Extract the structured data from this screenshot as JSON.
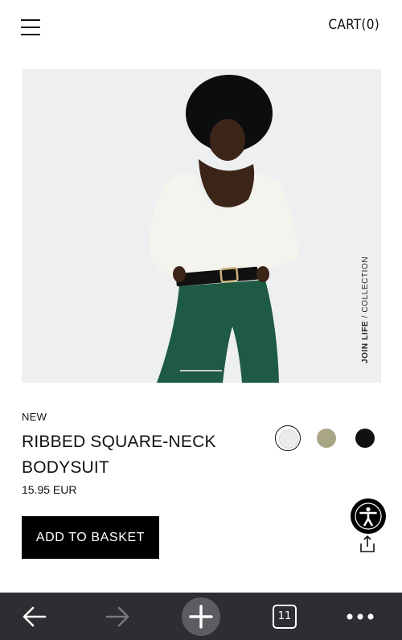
{
  "header": {
    "cart_label": "CART(0)"
  },
  "product": {
    "image_tag_bold": "JOIN LIFE",
    "image_tag_rest": " / COLLECTION",
    "badge": "NEW",
    "name": "RIBBED SQUARE-NECK BODYSUIT",
    "price": "15.95 EUR",
    "add_to_basket_label": "ADD TO BASKET"
  },
  "swatches": [
    {
      "color": "#ececec",
      "selected": true
    },
    {
      "color": "#a8a684",
      "selected": false
    },
    {
      "color": "#111111",
      "selected": false
    }
  ],
  "browser_bar": {
    "tab_count": "11",
    "background": "#2c2e31"
  }
}
